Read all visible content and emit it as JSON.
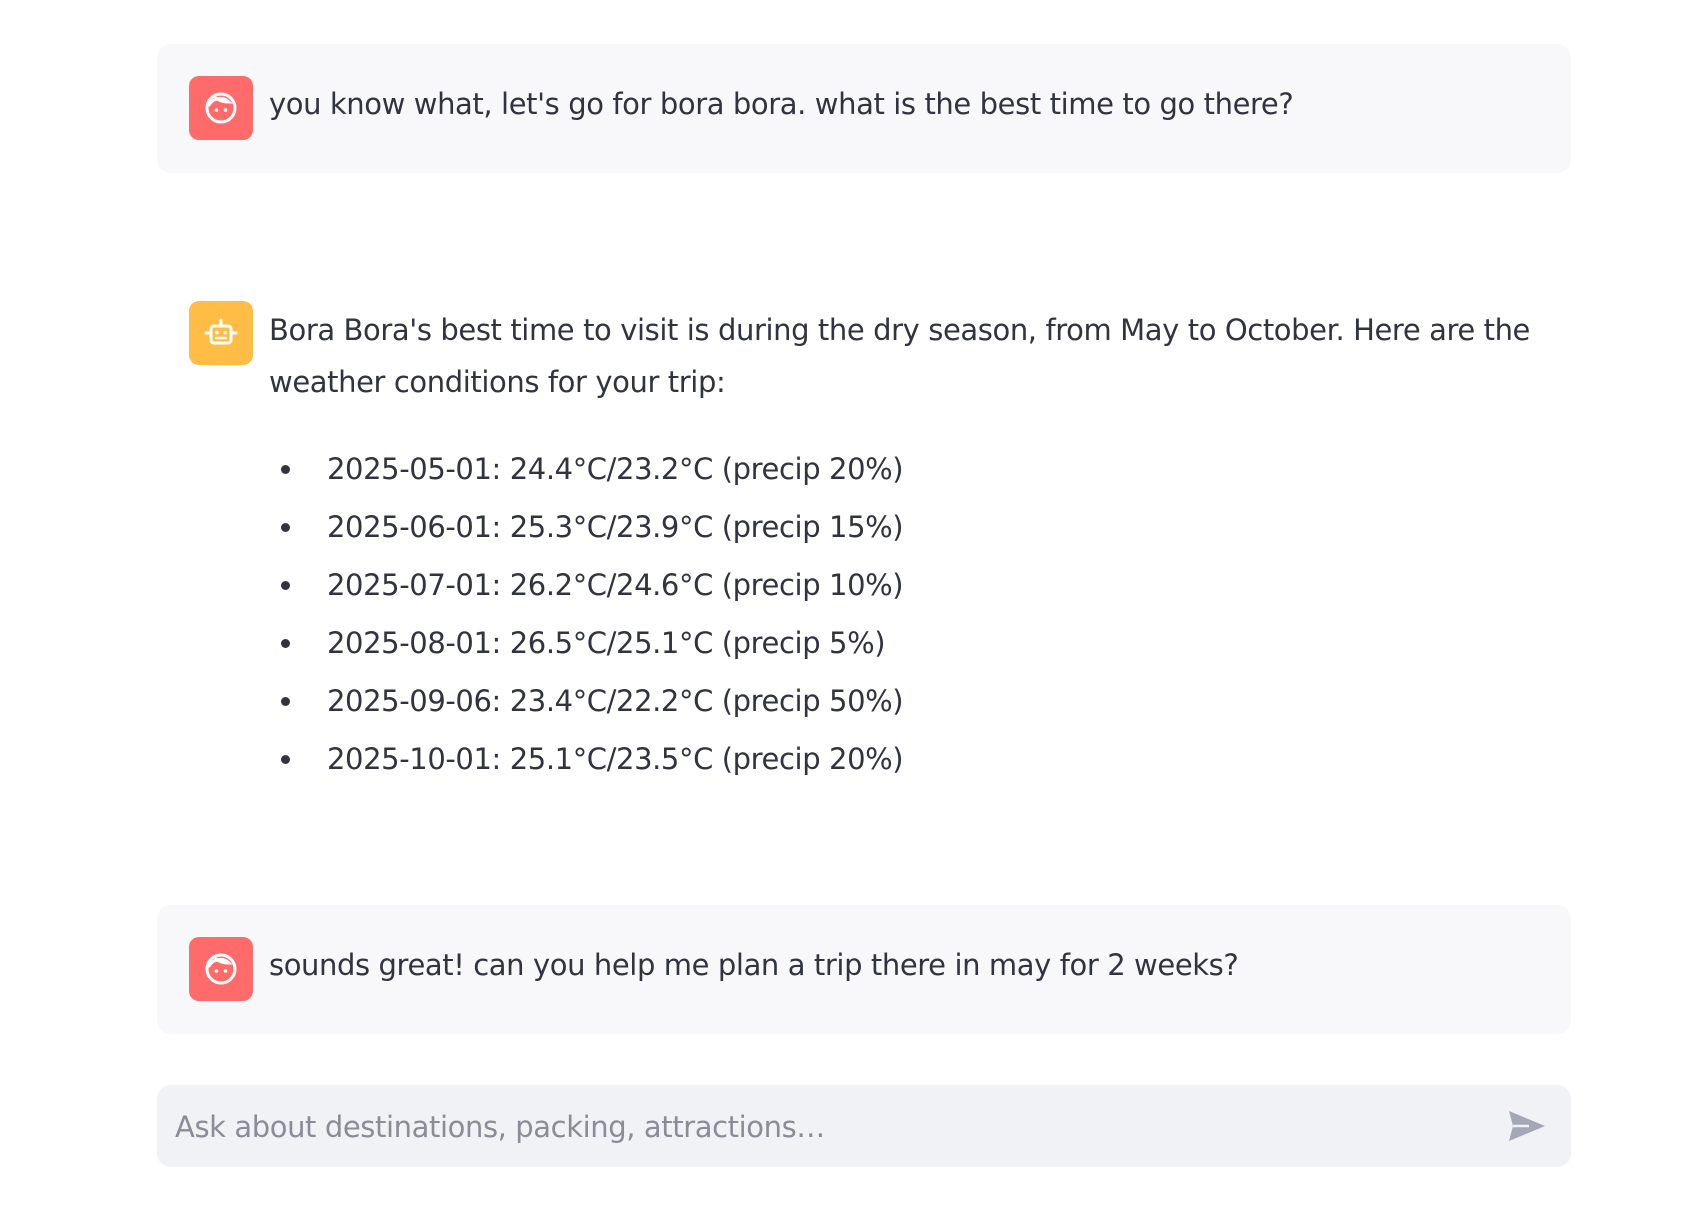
{
  "messages": [
    {
      "role": "user",
      "avatar_icon": "user-face-icon",
      "text": "you know what, let's go for bora bora. what is the best time to go there?"
    },
    {
      "role": "assistant",
      "avatar_icon": "robot-icon",
      "text": "Bora Bora's best time to visit is during the dry season, from May to October. Here are the weather conditions for your trip:",
      "bullets": [
        "2025-05-01: 24.4°C/23.2°C (precip 20%)",
        "2025-06-01: 25.3°C/23.9°C (precip 15%)",
        "2025-07-01: 26.2°C/24.6°C (precip 10%)",
        "2025-08-01: 26.5°C/25.1°C (precip 5%)",
        "2025-09-06: 23.4°C/22.2°C (precip 50%)",
        "2025-10-01: 25.1°C/23.5°C (precip 20%)"
      ]
    },
    {
      "role": "user",
      "avatar_icon": "user-face-icon",
      "text": "sounds great! can you help me plan a trip there in may for 2 weeks?"
    }
  ],
  "chat_input": {
    "placeholder": "Ask about destinations, packing, attractions…",
    "value": "",
    "send_icon": "send-icon"
  },
  "colors": {
    "user_avatar": "#ff6b6b",
    "assistant_avatar": "#ffbd45",
    "user_bubble": "#f8f8fa",
    "input_background": "#f0f2f6",
    "text": "#31333f"
  }
}
